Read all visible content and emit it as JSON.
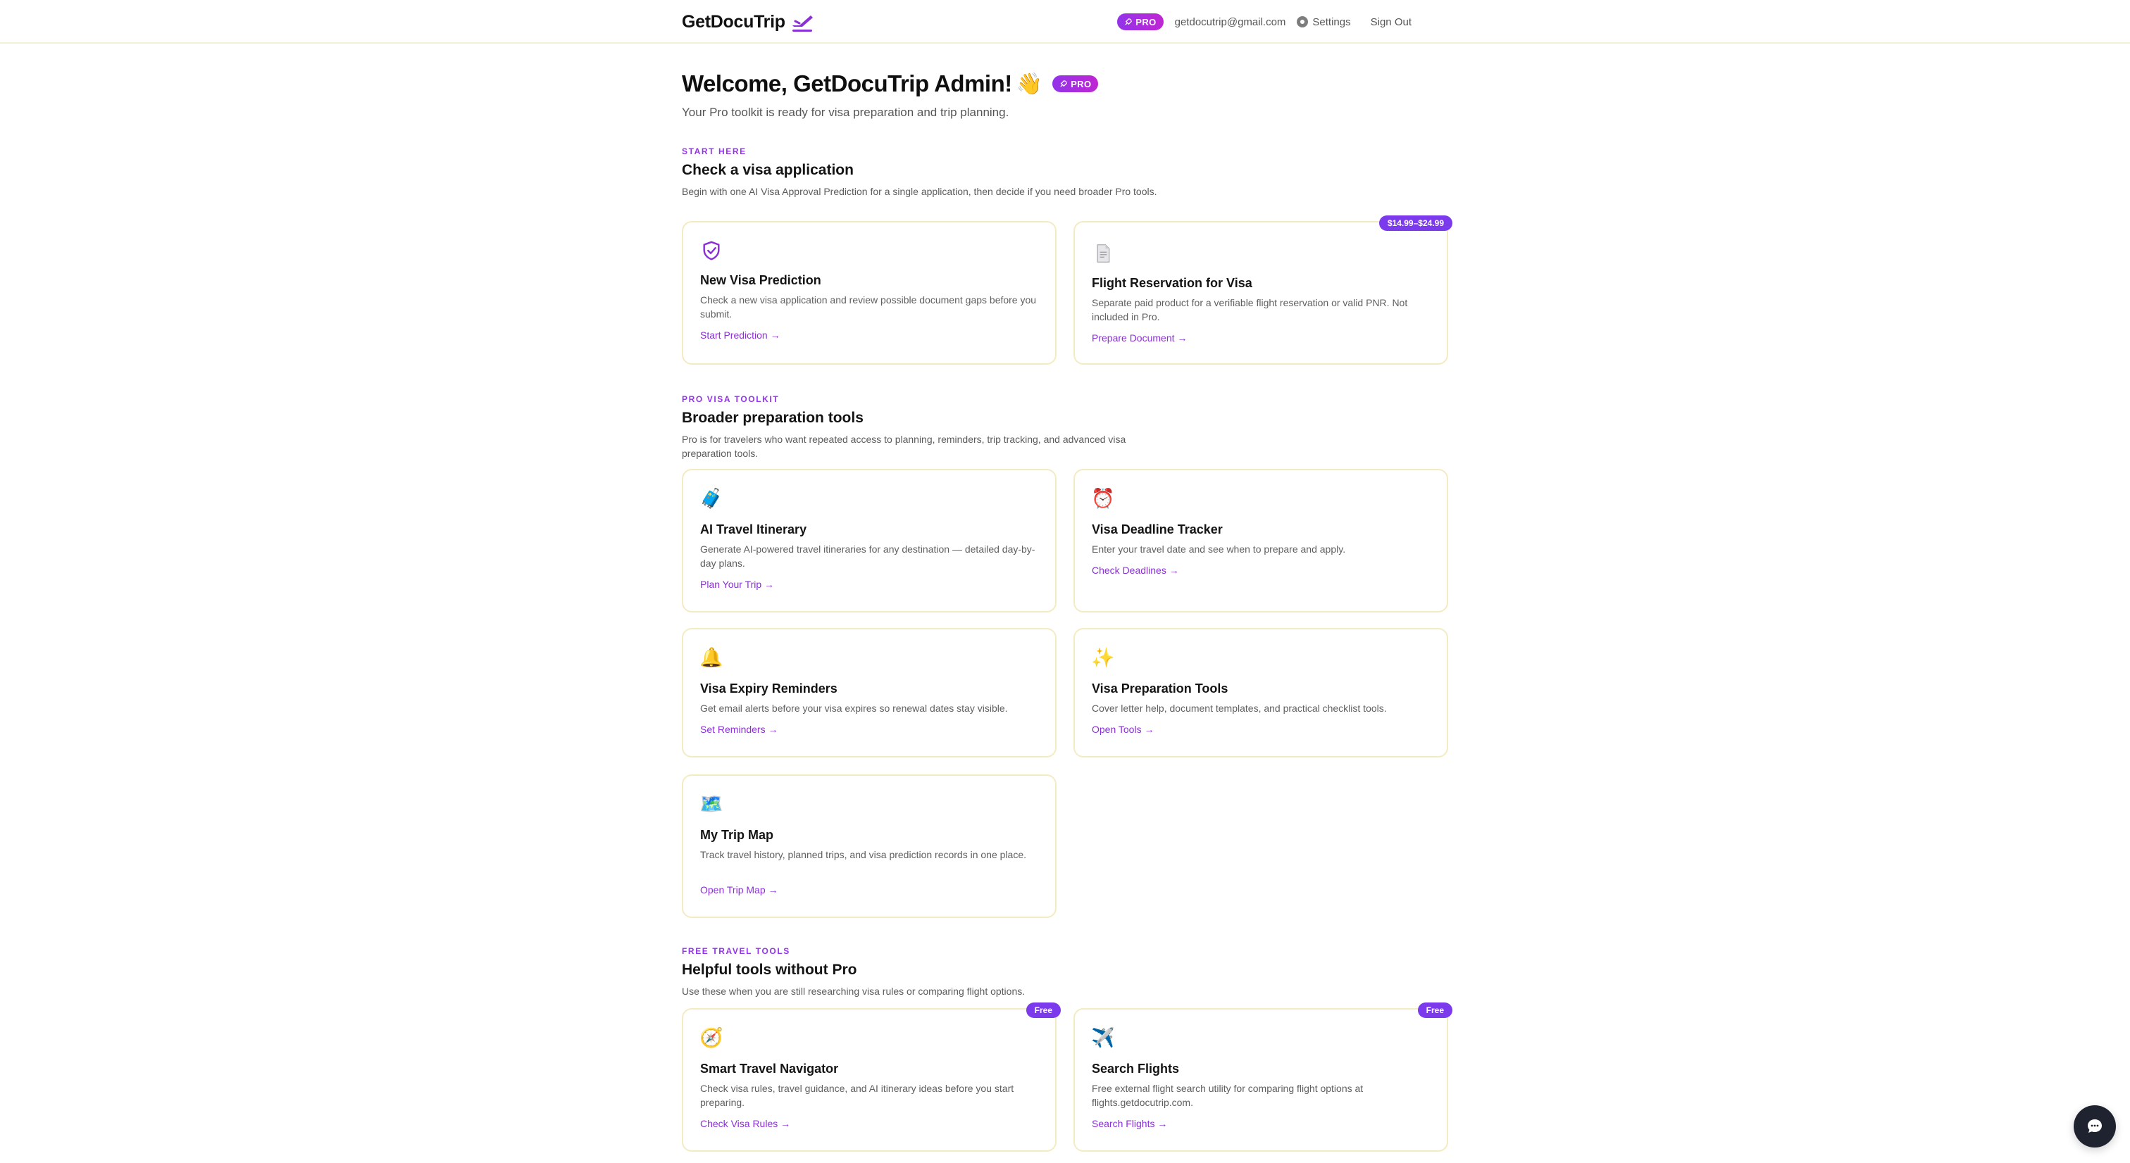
{
  "header": {
    "brand": "GetDocuTrip",
    "pro_badge": "PRO",
    "email": "getdocutrip@gmail.com",
    "settings": "Settings",
    "sign_out": "Sign Out"
  },
  "hero": {
    "title": "Welcome, GetDocuTrip Admin!",
    "wave": "👋",
    "badge": "PRO",
    "subtitle": "Your Pro toolkit is ready for visa preparation and trip planning."
  },
  "sections": {
    "start": {
      "eyebrow": "START HERE",
      "title": "Check a visa application",
      "desc": "Begin with one AI Visa Approval Prediction for a single application, then decide if you need broader Pro tools."
    },
    "pro": {
      "eyebrow": "PRO VISA TOOLKIT",
      "title": "Broader preparation tools",
      "desc": "Pro is for travelers who want repeated access to planning, reminders, trip tracking, and advanced visa preparation tools."
    },
    "free": {
      "eyebrow": "FREE TRAVEL TOOLS",
      "title": "Helpful tools without Pro",
      "desc": "Use these when you are still researching visa rules or comparing flight options."
    }
  },
  "cards": {
    "visa_prediction": {
      "icon": "shield-check-icon",
      "title": "New Visa Prediction",
      "desc": "Check a new visa application and review possible document gaps before you submit.",
      "link": "Start Prediction →"
    },
    "flight_reservation": {
      "icon": "document-icon",
      "badge": "$14.99–$24.99",
      "title": "Flight Reservation for Visa",
      "desc": "Separate paid product for a verifiable flight reservation or valid PNR. Not included in Pro.",
      "link": "Prepare Document →"
    },
    "itinerary": {
      "icon": "🧳",
      "title": "AI Travel Itinerary",
      "desc": "Generate AI-powered travel itineraries for any destination — detailed day-by-day plans.",
      "link": "Plan Your Trip →"
    },
    "deadline": {
      "icon": "⏰",
      "title": "Visa Deadline Tracker",
      "desc": "Enter your travel date and see when to prepare and apply.",
      "link": "Check Deadlines →"
    },
    "reminders": {
      "icon": "🔔",
      "title": "Visa Expiry Reminders",
      "desc": "Get email alerts before your visa expires so renewal dates stay visible.",
      "link": "Set Reminders →"
    },
    "prep_tools": {
      "icon": "✨",
      "title": "Visa Preparation Tools",
      "desc": "Cover letter help, document templates, and practical checklist tools.",
      "link": "Open Tools →"
    },
    "trip_map": {
      "icon": "🗺️",
      "title": "My Trip Map",
      "desc": "Track travel history, planned trips, and visa prediction records in one place.",
      "link": "Open Trip Map →"
    },
    "navigator": {
      "icon": "🧭",
      "badge": "Free",
      "title": "Smart Travel Navigator",
      "desc": "Check visa rules, travel guidance, and AI itinerary ideas before you start preparing.",
      "link": "Check Visa Rules →"
    },
    "flights": {
      "icon": "✈️",
      "badge": "Free",
      "title": "Search Flights",
      "desc": "Free external flight search utility for comparing flight options at flights.getdocutrip.com.",
      "link": "Search Flights →"
    }
  },
  "colors": {
    "accent": "#9333ea",
    "link": "#8b2fd6",
    "card_border": "#f3ecc2",
    "badge": "#7c3aed"
  }
}
